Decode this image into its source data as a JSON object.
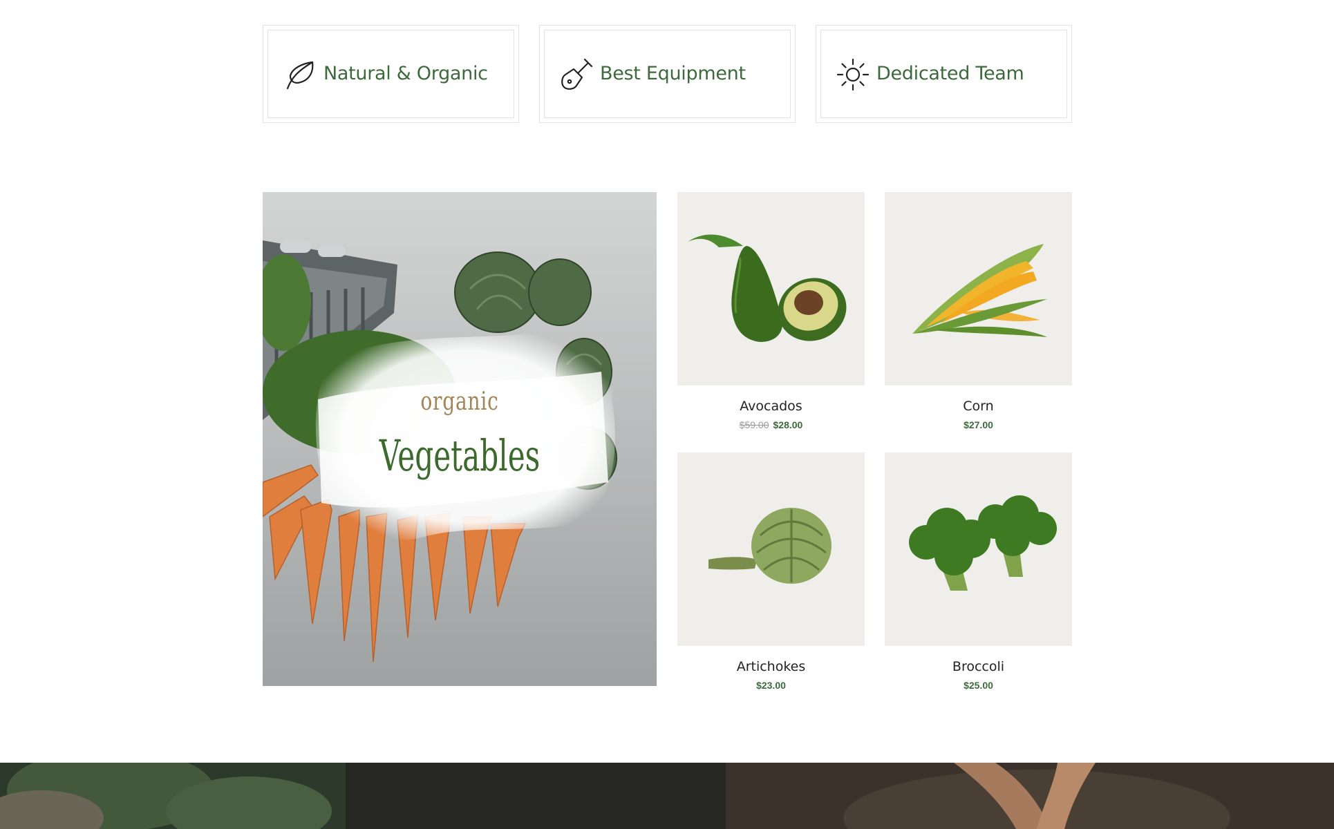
{
  "features": [
    {
      "icon": "leaf-icon",
      "label": "Natural & Organic"
    },
    {
      "icon": "shovel-icon",
      "label": "Best Equipment"
    },
    {
      "icon": "sun-icon",
      "label": "Dedicated Team"
    }
  ],
  "banner": {
    "subtitle": "organic",
    "title": "Vegetables"
  },
  "products": [
    {
      "name": "Avocados",
      "old_price": "$59.00",
      "price": "$28.00"
    },
    {
      "name": "Corn",
      "old_price": "",
      "price": "$27.00"
    },
    {
      "name": "Artichokes",
      "old_price": "",
      "price": "$23.00"
    },
    {
      "name": "Broccoli",
      "old_price": "",
      "price": "$25.00"
    }
  ],
  "colors": {
    "accent_green": "#3c6a3a",
    "banner_subtitle": "#a08558",
    "product_bg": "#efeeeb"
  }
}
